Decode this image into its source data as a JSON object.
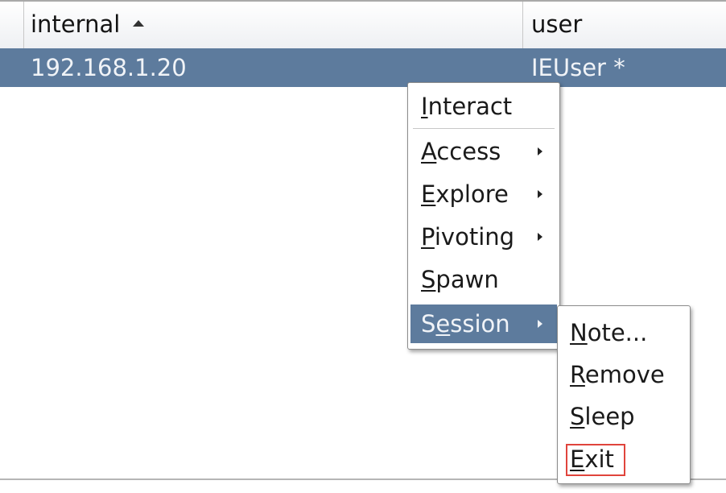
{
  "table": {
    "columns": [
      {
        "label": "internal",
        "sorted": "ascending"
      },
      {
        "label": "user"
      }
    ],
    "rows": [
      {
        "internal": "192.168.1.20",
        "user": "IEUser *",
        "selected": true
      }
    ]
  },
  "context_menu": {
    "items": [
      {
        "mnemonic": "I",
        "rest": "nteract",
        "pre": ""
      },
      {
        "mnemonic": "A",
        "rest": "ccess",
        "pre": ""
      },
      {
        "mnemonic": "E",
        "rest": "xplore",
        "pre": ""
      },
      {
        "mnemonic": "P",
        "rest": "ivoting",
        "pre": ""
      },
      {
        "mnemonic": "S",
        "rest": "pawn",
        "pre": ""
      },
      {
        "pre": "S",
        "mnemonic": "e",
        "rest": "ssion",
        "active": true
      }
    ]
  },
  "session_submenu": {
    "items": [
      {
        "mnemonic": "N",
        "rest": "ote..."
      },
      {
        "mnemonic": "R",
        "rest": "emove"
      },
      {
        "mnemonic": "S",
        "rest": "leep"
      },
      {
        "mnemonic": "E",
        "rest": "xit",
        "highlighted_box": true
      }
    ]
  },
  "colors": {
    "selection": "#5d7b9d",
    "highlight_box": "#e0443c"
  }
}
